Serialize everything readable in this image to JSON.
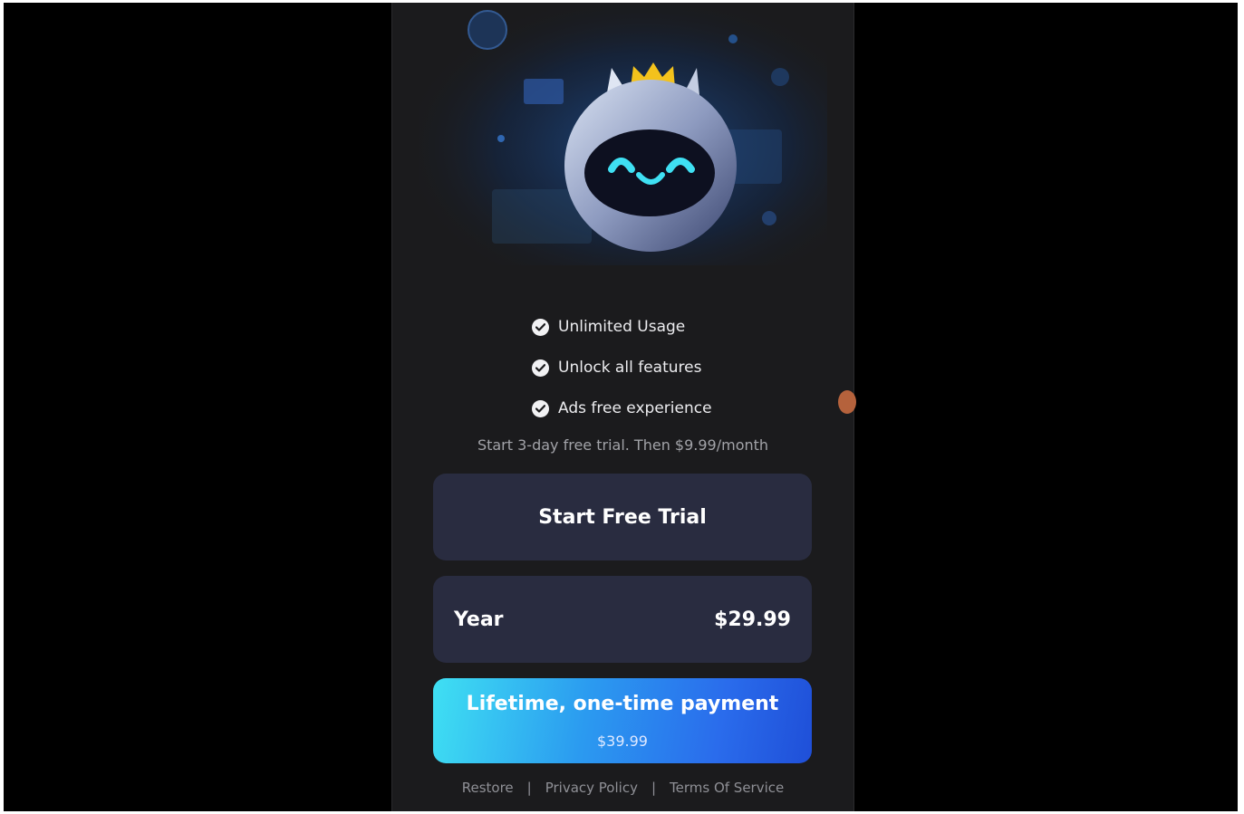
{
  "features": [
    {
      "label": "Unlimited Usage",
      "icon": "check-circle-icon"
    },
    {
      "label": "Unlock all features",
      "icon": "check-circle-icon"
    },
    {
      "label": "Ads free experience",
      "icon": "check-circle-icon"
    }
  ],
  "trial_note": "Start 3-day free trial. Then $9.99/month",
  "trial_button": {
    "label": "Start Free Trial"
  },
  "year_plan": {
    "label": "Year",
    "price": "$29.99"
  },
  "lifetime_plan": {
    "label": "Lifetime, one-time payment",
    "price": "$39.99"
  },
  "footer": {
    "restore": "Restore",
    "privacy": "Privacy Policy",
    "terms": "Terms Of Service",
    "separator": "|"
  },
  "colors": {
    "screen_bg": "#1b1b1d",
    "button_bg": "#292c40",
    "accent_cyan": "#3fe0f3",
    "accent_blue": "#2a6cec"
  }
}
